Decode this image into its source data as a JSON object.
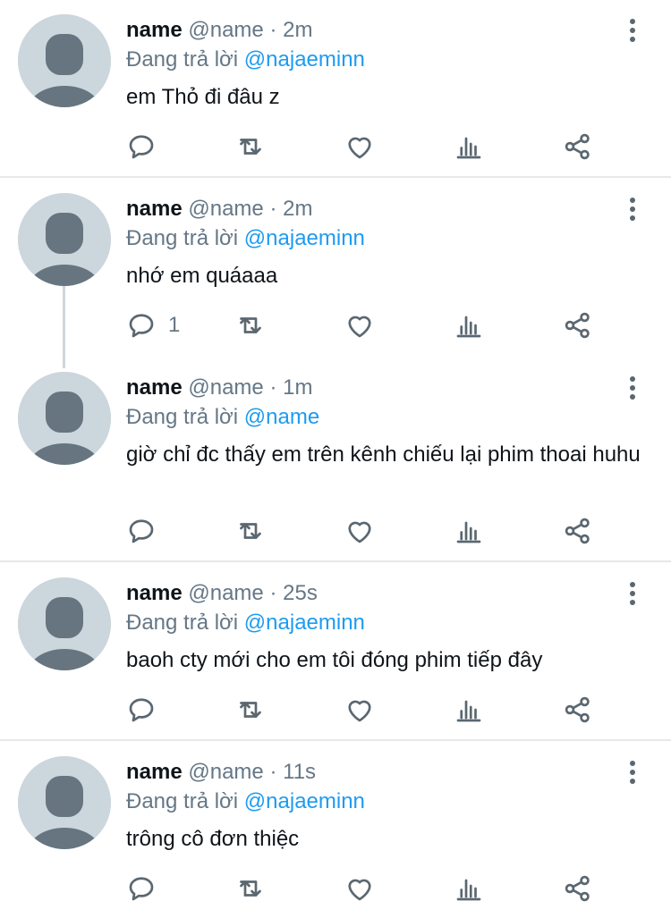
{
  "icons": {
    "avatar": "default-avatar-icon",
    "more": "more-vertical-icon",
    "reply": "reply-icon",
    "retweet": "retweet-icon",
    "like": "heart-icon",
    "views": "analytics-icon",
    "share": "share-icon"
  },
  "colors": {
    "mention": "#1d9bf0",
    "secondary_text": "#657786",
    "avatar_bg": "#ccd6dd",
    "avatar_fg": "#66757f",
    "divider": "#e6e8ea"
  },
  "tweets": [
    {
      "display_name": "name",
      "handle": "@name",
      "separator": "·",
      "time": "2m",
      "reply_prefix": "Đang trả lời",
      "reply_to": "@najaeminn",
      "text": "em Thỏ đi đâu z",
      "reply_count": ""
    },
    {
      "display_name": "name",
      "handle": "@name",
      "separator": "·",
      "time": "2m",
      "reply_prefix": "Đang trả lời",
      "reply_to": "@najaeminn",
      "text": "nhớ em quáaaa",
      "reply_count": "1"
    },
    {
      "display_name": "name",
      "handle": "@name",
      "separator": "·",
      "time": "1m",
      "reply_prefix": "Đang trả lời",
      "reply_to": "@name",
      "text": "giờ chỉ đc thấy em trên kênh chiếu lại phim thoai huhu",
      "reply_count": ""
    },
    {
      "display_name": "name",
      "handle": "@name",
      "separator": "·",
      "time": "25s",
      "reply_prefix": "Đang trả lời",
      "reply_to": "@najaeminn",
      "text": "baoh cty mới cho em tôi đóng phim tiếp đây",
      "reply_count": ""
    },
    {
      "display_name": "name",
      "handle": "@name",
      "separator": "·",
      "time": "11s",
      "reply_prefix": "Đang trả lời",
      "reply_to": "@najaeminn",
      "text": "trông cô đơn thiệc",
      "reply_count": ""
    }
  ]
}
